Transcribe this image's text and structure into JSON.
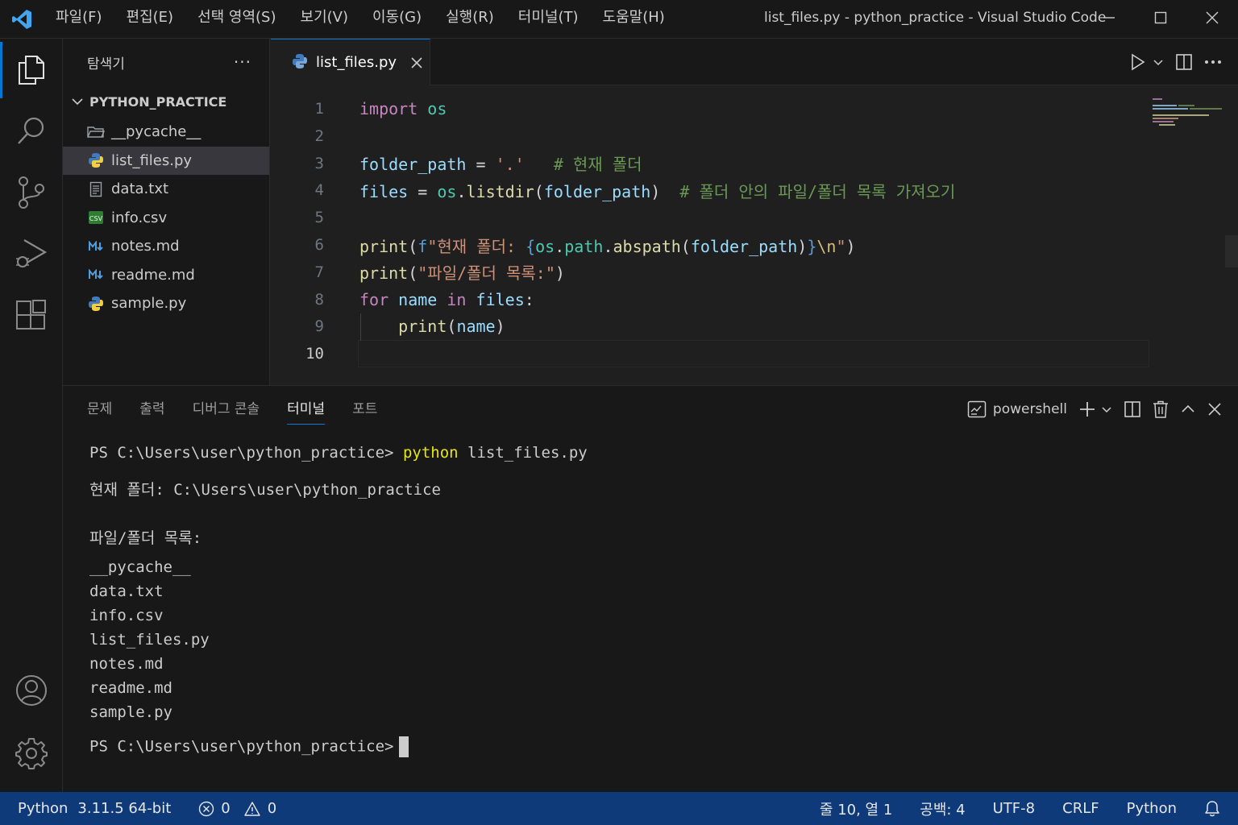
{
  "titlebar": {
    "menu": [
      "파일(F)",
      "편집(E)",
      "선택 영역(S)",
      "보기(V)",
      "이동(G)",
      "실행(R)",
      "터미널(T)",
      "도움말(H)"
    ],
    "window_title": "list_files.py - python_practice - Visual Studio Code"
  },
  "sidebar": {
    "title": "탐색기",
    "more": "···",
    "folder": "PYTHON_PRACTICE",
    "items": [
      {
        "label": "__pycache__",
        "icon": "folder-icon"
      },
      {
        "label": "list_files.py",
        "icon": "python-file-icon"
      },
      {
        "label": "data.txt",
        "icon": "text-file-icon"
      },
      {
        "label": "info.csv",
        "icon": "csv-file-icon"
      },
      {
        "label": "notes.md",
        "icon": "markdown-file-icon"
      },
      {
        "label": "readme.md",
        "icon": "markdown-file-icon"
      },
      {
        "label": "sample.py",
        "icon": "python-file-icon"
      }
    ]
  },
  "editor": {
    "tab_label": "list_files.py",
    "line_numbers": [
      "1",
      "2",
      "3",
      "4",
      "5",
      "6",
      "7",
      "8",
      "9",
      "10"
    ],
    "lines": [
      [
        {
          "t": "import",
          "c": "kw"
        },
        {
          "t": " ",
          "c": "op"
        },
        {
          "t": "os",
          "c": "mod"
        }
      ],
      [],
      [
        {
          "t": "folder_path",
          "c": "var"
        },
        {
          "t": " = ",
          "c": "op"
        },
        {
          "t": "'.'",
          "c": "str"
        },
        {
          "t": "   ",
          "c": "op"
        },
        {
          "t": "# 현재 폴더",
          "c": "com"
        }
      ],
      [
        {
          "t": "files",
          "c": "var"
        },
        {
          "t": " = ",
          "c": "op"
        },
        {
          "t": "os",
          "c": "mod"
        },
        {
          "t": ".",
          "c": "op"
        },
        {
          "t": "listdir",
          "c": "fn"
        },
        {
          "t": "(",
          "c": "op"
        },
        {
          "t": "folder_path",
          "c": "var"
        },
        {
          "t": ")",
          "c": "op"
        },
        {
          "t": "  ",
          "c": "op"
        },
        {
          "t": "# 폴더 안의 파일/폴더 목록 가져오기",
          "c": "com"
        }
      ],
      [],
      [
        {
          "t": "print",
          "c": "fn"
        },
        {
          "t": "(",
          "c": "op"
        },
        {
          "t": "f",
          "c": "bkw"
        },
        {
          "t": "\"현재 폴더: ",
          "c": "str"
        },
        {
          "t": "{",
          "c": "bkw"
        },
        {
          "t": "os",
          "c": "mod"
        },
        {
          "t": ".",
          "c": "op"
        },
        {
          "t": "path",
          "c": "mod"
        },
        {
          "t": ".",
          "c": "op"
        },
        {
          "t": "abspath",
          "c": "fn"
        },
        {
          "t": "(",
          "c": "op"
        },
        {
          "t": "folder_path",
          "c": "var"
        },
        {
          "t": ")",
          "c": "op"
        },
        {
          "t": "}",
          "c": "bkw"
        },
        {
          "t": "\\n",
          "c": "esc"
        },
        {
          "t": "\"",
          "c": "str"
        },
        {
          "t": ")",
          "c": "op"
        }
      ],
      [
        {
          "t": "print",
          "c": "fn"
        },
        {
          "t": "(",
          "c": "op"
        },
        {
          "t": "\"파일/폴더 목록:\"",
          "c": "str"
        },
        {
          "t": ")",
          "c": "op"
        }
      ],
      [
        {
          "t": "for",
          "c": "kw"
        },
        {
          "t": " ",
          "c": "op"
        },
        {
          "t": "name",
          "c": "var"
        },
        {
          "t": " ",
          "c": "op"
        },
        {
          "t": "in",
          "c": "kw"
        },
        {
          "t": " ",
          "c": "op"
        },
        {
          "t": "files",
          "c": "var"
        },
        {
          "t": ":",
          "c": "op"
        }
      ],
      [
        {
          "t": "    ",
          "c": "op"
        },
        {
          "t": "print",
          "c": "fn"
        },
        {
          "t": "(",
          "c": "op"
        },
        {
          "t": "name",
          "c": "var"
        },
        {
          "t": ")",
          "c": "op"
        }
      ],
      []
    ]
  },
  "panel": {
    "tabs": [
      "문제",
      "출력",
      "디버그 콘솔",
      "터미널",
      "포트"
    ],
    "active_tab": 3,
    "shell": "powershell",
    "prompt": "PS C:\\Users\\user\\python_practice> ",
    "command": "python",
    "command_args": " list_files.py",
    "output_current": "현재 폴더: C:\\Users\\user\\python_practice",
    "output_list_header": "파일/폴더 목록:",
    "output_list": [
      "__pycache__",
      "data.txt",
      "info.csv",
      "list_files.py",
      "notes.md",
      "readme.md",
      "sample.py"
    ],
    "final_prompt": "PS C:\\Users\\user\\python_practice>"
  },
  "statusbar": {
    "interpreter": "Python",
    "version": "3.11.5 64-bit",
    "errors": "0",
    "warnings": "0",
    "position": "줄 10, 열 1",
    "spaces": "공백: 4",
    "encoding": "UTF-8",
    "eol": "CRLF",
    "language": "Python"
  },
  "colors": {
    "accent": "#0078d4",
    "statusbar": "#0e3a7a",
    "background": "#1f1f1f"
  }
}
